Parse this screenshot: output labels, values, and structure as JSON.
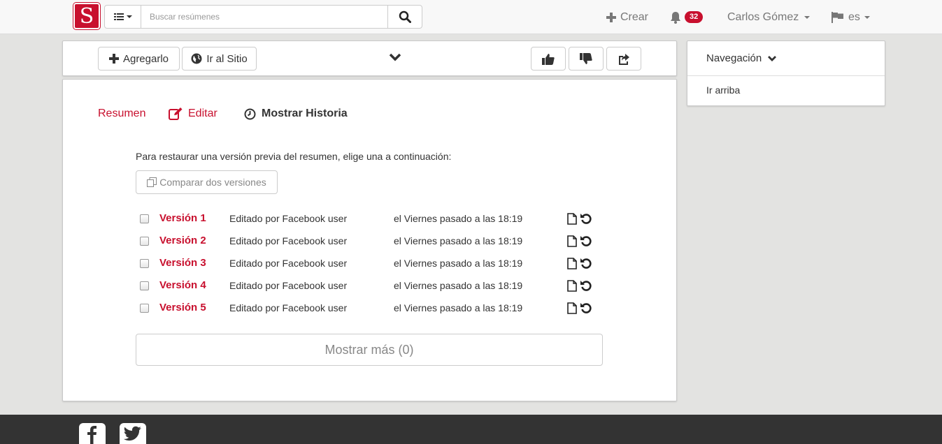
{
  "navbar": {
    "logo_letter": "S",
    "search_placeholder": "Buscar resúmenes",
    "create_label": "Crear",
    "notifications_count": "32",
    "user_name": "Carlos Gómez",
    "language": "es"
  },
  "toolbar": {
    "add_label": "Agregarlo",
    "site_label": "Ir al Sitio"
  },
  "tabs": {
    "summary": "Resumen",
    "edit": "Editar",
    "history": "Mostrar Historia"
  },
  "history": {
    "restore_text": "Para restaurar una versión previa del resumen, elige una a continuación:",
    "compare_label": "Comparar dos versiones",
    "versions": [
      {
        "label": "Versión 1",
        "editor": "Editado por Facebook user",
        "date": "el Viernes pasado a las 18:19"
      },
      {
        "label": "Versión 2",
        "editor": "Editado por Facebook user",
        "date": "el Viernes pasado a las 18:19"
      },
      {
        "label": "Versión 3",
        "editor": "Editado por Facebook user",
        "date": "el Viernes pasado a las 18:19"
      },
      {
        "label": "Versión 4",
        "editor": "Editado por Facebook user",
        "date": "el Viernes pasado a las 18:19"
      },
      {
        "label": "Versión 5",
        "editor": "Editado por Facebook user",
        "date": "el Viernes pasado a las 18:19"
      }
    ],
    "show_more_label": "Mostrar más (0)"
  },
  "sidebar": {
    "nav_label": "Navegación",
    "top_link": "Ir arriba"
  },
  "colors": {
    "brand": "#c8102e",
    "background": "#e3e3e1",
    "footer": "#333333"
  },
  "icons": [
    "list-icon",
    "search-icon",
    "plus-icon",
    "bell-icon",
    "flag-icon",
    "globe-icon",
    "chevron-down-icon",
    "thumbs-up-icon",
    "thumbs-down-icon",
    "share-icon",
    "edit-icon",
    "clock-icon",
    "copy-icon",
    "document-icon",
    "restore-icon",
    "facebook-icon",
    "twitter-icon"
  ]
}
